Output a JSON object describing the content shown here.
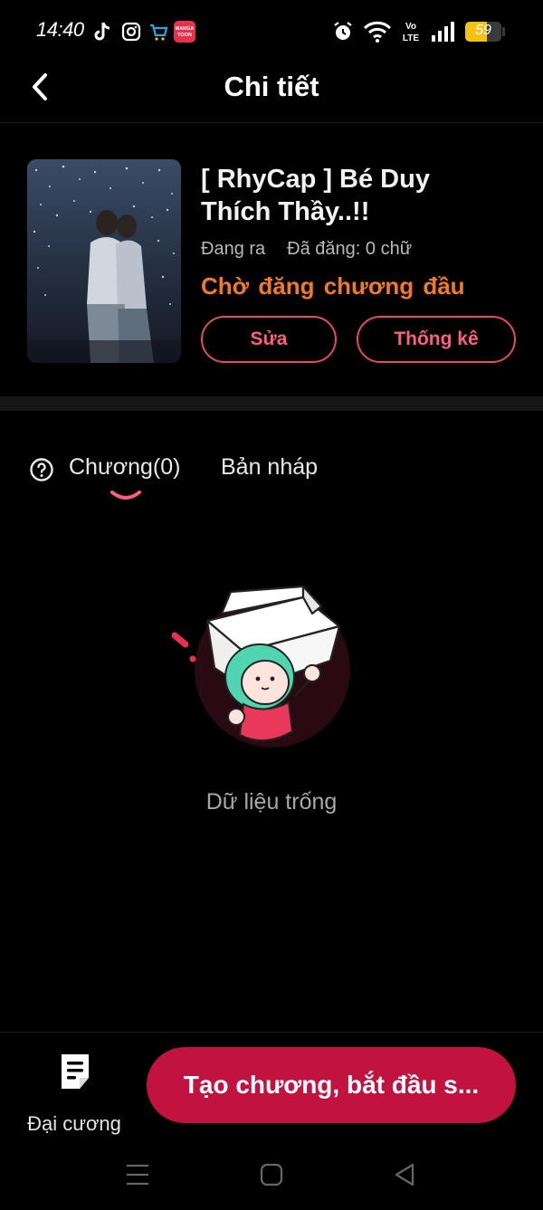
{
  "status_bar": {
    "time": "14:40",
    "battery_level": "59",
    "battery_percent": 59,
    "app_icons": [
      "tiktok-icon",
      "instagram-icon",
      "shopping-icon",
      "manga-toon-icon"
    ],
    "system_icons": [
      "alarm-icon",
      "wifi-icon",
      "volte-icon",
      "signal-icon",
      "battery-icon"
    ],
    "volte_label": "Vo LTE",
    "manga_badge": "MANGA TOON"
  },
  "header": {
    "title": "Chi tiết",
    "back_icon": "chevron-left-icon"
  },
  "story": {
    "title": "[ RhyCap ] Bé Duy Thích Thầy..!!",
    "state": "Đang ra",
    "word_count": "Đã đăng: 0 chữ",
    "status": "Chờ đăng chương đầu",
    "edit_label": "Sửa",
    "stats_label": "Thống kê"
  },
  "tabs": {
    "chapters_label": "Chương(0)",
    "drafts_label": "Bản nháp",
    "active": "chapters"
  },
  "empty_state": {
    "text": "Dữ liệu trống"
  },
  "bottom": {
    "outline_label": "Đại cương",
    "create_label": "Tạo chương, bắt đầu s..."
  },
  "colors": {
    "accent": "#c2123f",
    "accent_outline": "#e8466a",
    "status_orange": "#f17a25",
    "background": "#000000"
  }
}
